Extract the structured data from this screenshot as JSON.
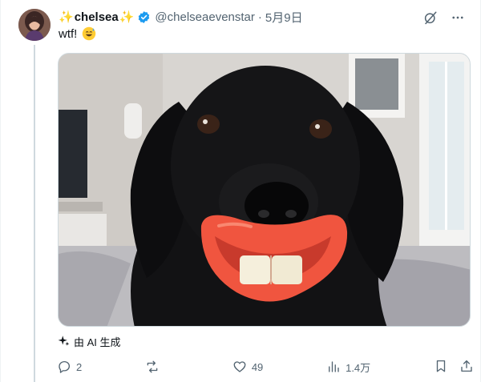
{
  "post": {
    "display_name": "chelsea",
    "sparkle_left": "✨",
    "sparkle_right": "✨",
    "handle": "@chelseaevenstar",
    "separator": "·",
    "date": "5月9日",
    "text": "wtf!",
    "emoji": "sweat-smile-emoji",
    "verified_icon": "verified-badge-icon",
    "ai_label": "由 AI 生成"
  },
  "actions": {
    "reply_count": "2",
    "repost_count": "",
    "like_count": "49",
    "views_count": "1.4万"
  },
  "icons": {
    "grok": "grok-icon",
    "more": "more-dots-icon",
    "reply": "reply-icon",
    "repost": "repost-icon",
    "like": "heart-icon",
    "views": "views-chart-icon",
    "bookmark": "bookmark-icon",
    "share": "share-icon",
    "ai": "ai-sparkle-icon"
  },
  "colors": {
    "accent": "#1d9bf0",
    "text": "#0f1419",
    "muted": "#536471",
    "sparkle": "#f5b400",
    "lips": "#f0553f"
  }
}
